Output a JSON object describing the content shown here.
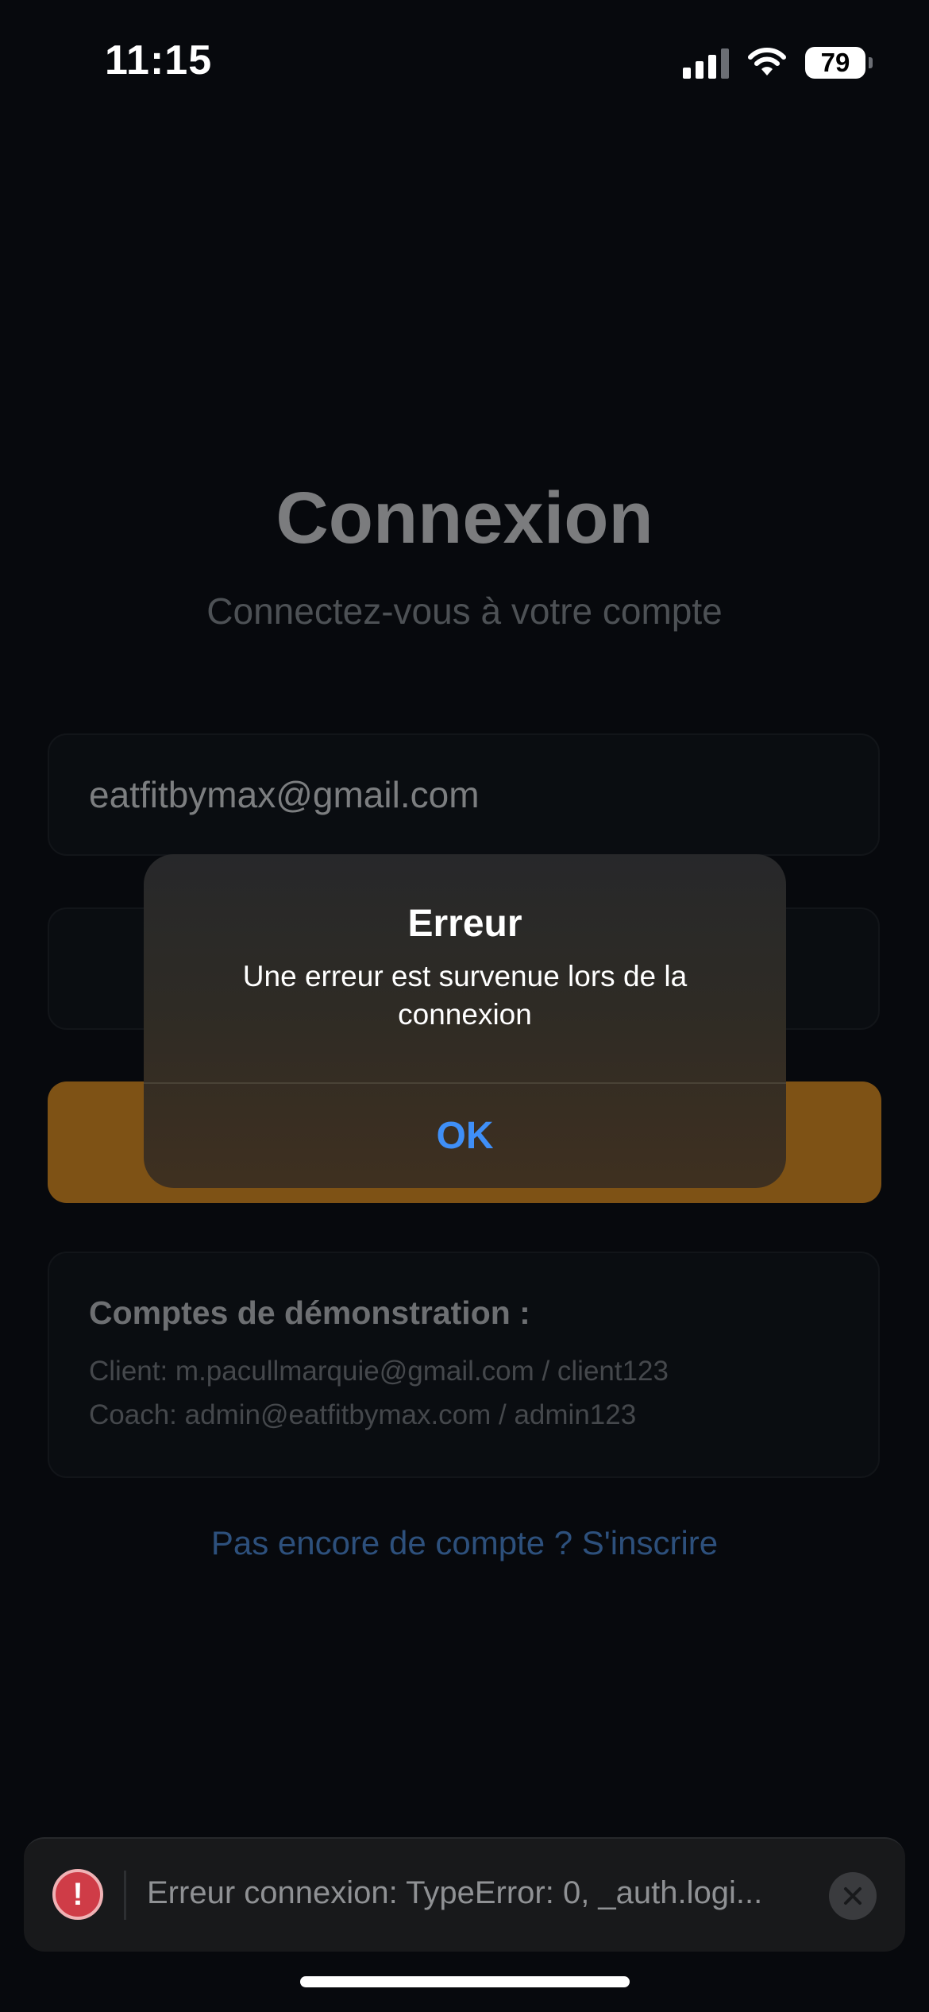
{
  "status_bar": {
    "time": "11:15",
    "battery": "79"
  },
  "login": {
    "title": "Connexion",
    "subtitle": "Connectez-vous à votre compte",
    "email_value": "eatfitbymax@gmail.com",
    "password_value": "",
    "button_label": ""
  },
  "demo": {
    "title": "Comptes de démonstration :",
    "client_line": "Client: m.pacullmarquie@gmail.com / client123",
    "coach_line": "Coach: admin@eatfitbymax.com / admin123"
  },
  "signup_link": "Pas encore de compte ? S'inscrire",
  "alert": {
    "title": "Erreur",
    "message": "Une erreur est survenue lors de la connexion",
    "ok_label": "OK"
  },
  "toast": {
    "icon_symbol": "!",
    "message": "Erreur connexion: TypeError: 0, _auth.logi..."
  },
  "colors": {
    "background": "#07090d",
    "accent_button": "#7e5215",
    "link": "#2d507c",
    "alert_ok": "#3f8ff7",
    "error": "#cf3c47"
  }
}
